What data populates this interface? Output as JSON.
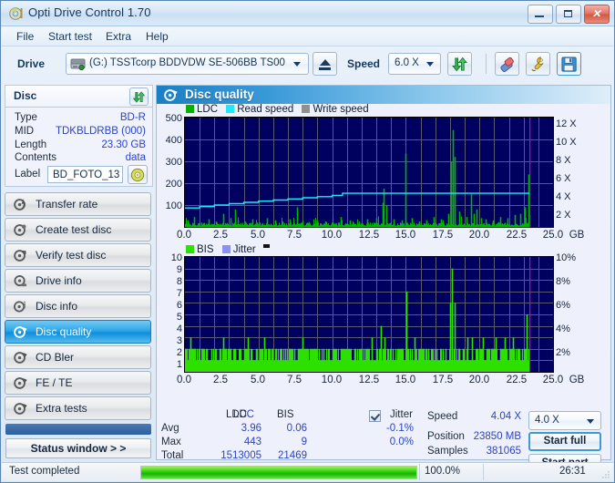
{
  "window": {
    "title": "Opti Drive Control 1.70",
    "icon": "disc-icon",
    "buttons": {
      "minimize": "minimize-icon",
      "maximize": "maximize-icon",
      "close": "close-icon"
    }
  },
  "menu": {
    "items": [
      "File",
      "Start test",
      "Extra",
      "Help"
    ]
  },
  "toolbar": {
    "drive_label": "Drive",
    "drive_value": "(G:)  TSSTcorp BDDVDW SE-506BB TS00",
    "eject_icon": "eject-icon",
    "speed_label": "Speed",
    "speed_value": "6.0 X",
    "refresh_icon": "refresh-icon",
    "erase_icon": "eraser-icon",
    "tools_icon": "tools-icon",
    "save_icon": "save-icon"
  },
  "disc": {
    "panel_title": "Disc",
    "swap_icon": "refresh-icon",
    "fields": [
      {
        "key": "Type",
        "value": "BD-R"
      },
      {
        "key": "MID",
        "value": "TDKBLDRBB (000)"
      },
      {
        "key": "Length",
        "value": "23.30 GB"
      },
      {
        "key": "Contents",
        "value": "data"
      }
    ],
    "label_key": "Label",
    "label_value": "BD_FOTO_13",
    "disc_icon": "cd-icon"
  },
  "sidebar": {
    "items": [
      {
        "label": "Transfer rate",
        "icon": "disc-speed-icon",
        "selected": false
      },
      {
        "label": "Create test disc",
        "icon": "disc-burn-icon",
        "selected": false
      },
      {
        "label": "Verify test disc",
        "icon": "disc-verify-icon",
        "selected": false
      },
      {
        "label": "Drive info",
        "icon": "drive-info-icon",
        "selected": false
      },
      {
        "label": "Disc info",
        "icon": "disc-info-icon",
        "selected": false
      },
      {
        "label": "Disc quality",
        "icon": "disc-quality-icon",
        "selected": true
      },
      {
        "label": "CD Bler",
        "icon": "disc-bler-icon",
        "selected": false
      },
      {
        "label": "FE / TE",
        "icon": "disc-fete-icon",
        "selected": false
      },
      {
        "label": "Extra tests",
        "icon": "disc-extra-icon",
        "selected": false
      }
    ],
    "status_window_button": "Status window > >"
  },
  "content": {
    "header_title": "Disc quality",
    "header_icon": "disc-quality-icon"
  },
  "stats": {
    "col_ldc": "LDC",
    "col_bis": "BIS",
    "col_jitter": "Jitter",
    "jitter_checked": true,
    "rows": [
      {
        "name": "Avg",
        "ldc": "3.96",
        "bis": "0.06",
        "jitter": "-0.1%"
      },
      {
        "name": "Max",
        "ldc": "443",
        "bis": "9",
        "jitter": "0.0%"
      },
      {
        "name": "Total",
        "ldc": "1513005",
        "bis": "21469",
        "jitter": ""
      }
    ],
    "speed_label": "Speed",
    "speed_value": "4.04 X",
    "position_label": "Position",
    "position_value": "23850 MB",
    "samples_label": "Samples",
    "samples_value": "381065",
    "speed_select": "4.0 X",
    "start_full": "Start full",
    "start_part": "Start part"
  },
  "statusbar": {
    "message": "Test completed",
    "percent": "100.0%",
    "progress": 100,
    "elapsed": "26:31"
  },
  "colors": {
    "ldc_green": "#00b400",
    "bis_green": "#2ee000",
    "read_speed_cyan": "#20e8f8",
    "write_speed_gray": "#909090",
    "jitter_blue": "#8a92f0",
    "plot_bg": "#000060",
    "accent_blue": "#1a7fc4",
    "value_blue": "#2b43c8",
    "progress_green": "#20c808",
    "marker_magenta": "#d000b0"
  },
  "chart_data": [
    {
      "type": "line",
      "id": "disc-quality-top-chart",
      "title": "",
      "legend": [
        {
          "label": "LDC",
          "color": "#00b400"
        },
        {
          "label": "Read speed",
          "color": "#20e8f8"
        },
        {
          "label": "Write speed",
          "color": "#909090"
        }
      ],
      "legend_position": "top-left",
      "grid": true,
      "xlabel": "GB",
      "xlim": [
        0,
        25.0
      ],
      "xticks": [
        "0.0",
        "2.5",
        "5.0",
        "7.5",
        "10.0",
        "12.5",
        "15.0",
        "17.5",
        "20.0",
        "22.5",
        "25.0"
      ],
      "ylabel": "LDC",
      "ylim": [
        0,
        500
      ],
      "yticks": [
        100,
        200,
        300,
        400,
        500
      ],
      "y2label": "X",
      "y2lim": [
        0,
        13
      ],
      "y2ticks": [
        "2 X",
        "4 X",
        "6 X",
        "8 X",
        "10 X",
        "12 X"
      ],
      "end_marker_gb": 23.4,
      "series": [
        {
          "name": "Read speed",
          "color": "#20e8f8",
          "axis": "right",
          "x": [
            0.0,
            1.0,
            2.0,
            3.0,
            4.0,
            5.0,
            6.0,
            7.0,
            8.0,
            9.0,
            10.0,
            10.7,
            12.0,
            15.0,
            18.0,
            21.0,
            23.4
          ],
          "y": [
            2.25,
            2.42,
            2.6,
            2.76,
            2.92,
            3.07,
            3.2,
            3.33,
            3.47,
            3.6,
            3.75,
            4.0,
            4.0,
            4.0,
            4.0,
            4.0,
            4.0
          ]
        },
        {
          "name": "LDC",
          "color": "#00b400",
          "axis": "left",
          "note": "dense error-count spikes across full disc; baseline near 0-20",
          "x": [
            0.2,
            0.6,
            1.1,
            1.6,
            2.1,
            2.6,
            3.1,
            3.4,
            3.6,
            4.1,
            4.6,
            5.1,
            5.6,
            6.1,
            6.6,
            7.1,
            7.6,
            8.0,
            8.4,
            9.0,
            9.5,
            10.0,
            10.6,
            11.2,
            11.8,
            12.4,
            13.0,
            13.4,
            13.5,
            13.7,
            14.2,
            14.7,
            15.0,
            15.4,
            15.9,
            16.4,
            16.9,
            17.4,
            17.9,
            18.1,
            18.2,
            18.3,
            18.6,
            19.1,
            19.4,
            19.6,
            19.8,
            20.1,
            20.4,
            20.9,
            21.4,
            21.9,
            22.4,
            22.8,
            23.1,
            23.3,
            23.4
          ],
          "y": [
            30,
            45,
            20,
            35,
            25,
            60,
            40,
            80,
            30,
            25,
            35,
            20,
            40,
            30,
            25,
            35,
            90,
            28,
            22,
            30,
            25,
            20,
            45,
            30,
            25,
            35,
            40,
            110,
            175,
            100,
            35,
            30,
            335,
            40,
            25,
            30,
            45,
            35,
            60,
            300,
            443,
            320,
            70,
            45,
            150,
            60,
            80,
            40,
            35,
            30,
            45,
            40,
            55,
            60,
            90,
            240,
            55
          ]
        }
      ]
    },
    {
      "type": "line",
      "id": "disc-quality-bottom-chart",
      "title": "",
      "legend": [
        {
          "label": "BIS",
          "color": "#2ee000"
        },
        {
          "label": "Jitter",
          "color": "#8a92f0"
        }
      ],
      "legend_position": "top-left",
      "grid": true,
      "xlabel": "GB",
      "xlim": [
        0,
        25.0
      ],
      "xticks": [
        "0.0",
        "2.5",
        "5.0",
        "7.5",
        "10.0",
        "12.5",
        "15.0",
        "17.5",
        "20.0",
        "22.5",
        "25.0"
      ],
      "ylabel": "BIS",
      "ylim": [
        0,
        10
      ],
      "yticks": [
        1,
        2,
        3,
        4,
        5,
        6,
        7,
        8,
        9,
        10
      ],
      "y2label": "%",
      "y2lim": [
        0,
        10
      ],
      "y2ticks": [
        "2%",
        "4%",
        "6%",
        "8%",
        "10%"
      ],
      "end_marker_gb": 23.4,
      "series": [
        {
          "name": "BIS",
          "color": "#2ee000",
          "axis": "left",
          "note": "dense bars mostly 1-2, occasional 3, peaks at 15.05 GB (7) and 18.15 GB (9), 23.2 GB (5)",
          "baseline": 1,
          "x": [
            0.1,
            0.35,
            0.55,
            0.7,
            0.9,
            1.2,
            1.5,
            1.8,
            2.1,
            2.35,
            2.6,
            2.8,
            3.1,
            3.4,
            3.7,
            4.0,
            4.25,
            4.5,
            4.8,
            5.1,
            5.4,
            5.7,
            5.95,
            6.2,
            6.5,
            6.8,
            7.1,
            7.4,
            7.7,
            8.0,
            8.2,
            8.5,
            8.8,
            9.1,
            9.4,
            9.7,
            10.0,
            10.3,
            10.6,
            10.9,
            11.2,
            11.5,
            11.8,
            12.1,
            12.4,
            12.7,
            13.0,
            13.3,
            13.55,
            13.8,
            14.1,
            14.4,
            14.7,
            15.05,
            15.3,
            15.6,
            15.9,
            16.2,
            16.5,
            16.8,
            17.1,
            17.4,
            17.7,
            18.0,
            18.15,
            18.3,
            18.6,
            18.9,
            19.2,
            19.5,
            19.8,
            20.0,
            20.25,
            20.5,
            20.8,
            21.1,
            21.4,
            21.7,
            22.0,
            22.3,
            22.6,
            22.9,
            23.2,
            23.35
          ],
          "y": [
            2,
            3,
            2,
            2,
            2,
            2,
            2,
            2,
            2,
            2,
            3,
            2,
            2,
            2,
            2,
            2,
            3,
            2,
            2,
            2,
            3,
            2,
            2,
            2,
            2,
            2,
            2,
            2,
            2,
            3,
            2,
            2,
            2,
            2,
            2,
            2,
            2,
            2,
            2,
            2,
            2,
            2,
            2,
            2,
            2,
            3,
            2,
            4,
            3,
            2,
            2,
            2,
            2,
            7,
            2,
            3,
            2,
            2,
            2,
            2,
            2,
            2,
            2,
            6,
            9,
            6,
            2,
            2,
            3,
            3,
            2,
            2,
            3,
            2,
            2,
            3,
            2,
            3,
            2,
            3,
            2,
            2,
            5,
            2
          ]
        }
      ]
    }
  ]
}
